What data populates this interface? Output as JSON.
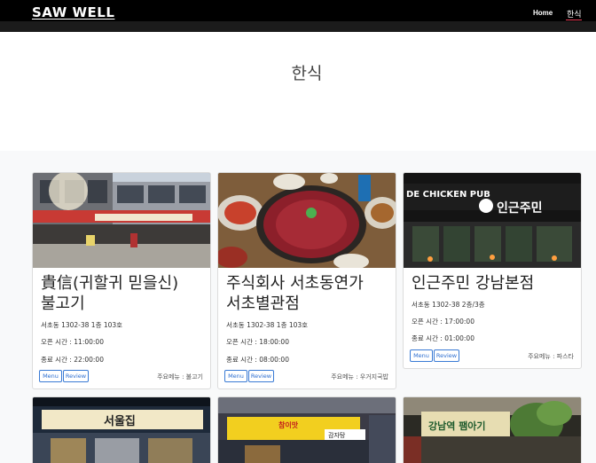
{
  "brand": "SAW WELL",
  "nav": {
    "home": "Home",
    "active": "한식"
  },
  "page_title": "한식",
  "cards": [
    {
      "name_line1": "貴信(귀할귀 믿을신)",
      "name_line2": "불고기",
      "address": "서초동 1302-38 1층 103호",
      "open": "오픈 시간 : 11:00:00",
      "close": "종료 시간 : 22:00:00",
      "menu_btn": "Menu",
      "review_btn": "Review",
      "main_menu": "주요메뉴 : 불고기"
    },
    {
      "name_line1": "주식회사 서초동연가",
      "name_line2": "서초별관점",
      "address": "서초동 1302-38 1층 103호",
      "open": "오픈 시간 : 18:00:00",
      "close": "종료 시간 : 08:00:00",
      "menu_btn": "Menu",
      "review_btn": "Review",
      "main_menu": "주요메뉴 : 우거지국밥"
    },
    {
      "name_line1": "인근주민 강남본점",
      "address": "서초동 1302-38 2층/3층",
      "open": "오픈 시간 : 17:00:00",
      "close": "종료 시간 : 01:00:00",
      "menu_btn": "Menu",
      "review_btn": "Review",
      "main_menu": "주요메뉴 : 파스타"
    }
  ],
  "photo_signs": {
    "card3": "DE CHICKEN PUB",
    "card3_korean": "인근주민",
    "card4": "서울집",
    "card5": "참이맛",
    "card5b": "감자탕",
    "card6": "강남역 팸아기"
  },
  "colors": {
    "accent": "#e83e56",
    "button": "#2e6fd0",
    "navbar": "#000000"
  }
}
